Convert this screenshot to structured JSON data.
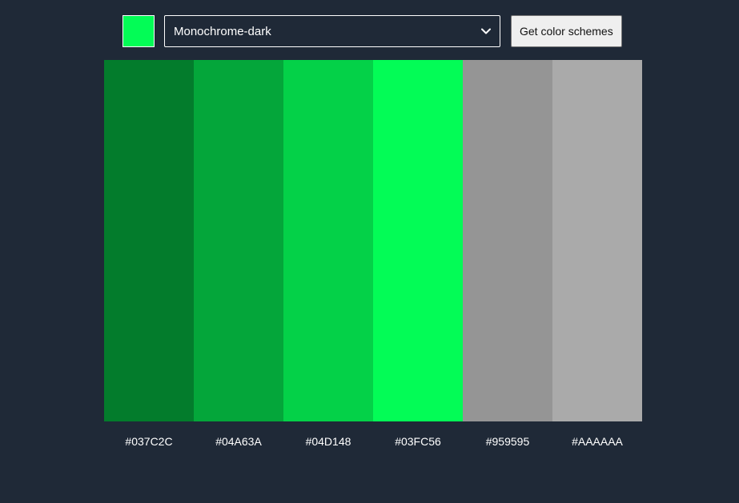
{
  "seed_color": "#03FC56",
  "mode_select": {
    "selected": "Monochrome-dark",
    "chevron_icon": "chevron-down-icon"
  },
  "get_button_label": "Get color schemes",
  "scheme": [
    {
      "hex": "#037C2C"
    },
    {
      "hex": "#04A63A"
    },
    {
      "hex": "#04D148"
    },
    {
      "hex": "#03FC56"
    },
    {
      "hex": "#959595"
    },
    {
      "hex": "#AAAAAA"
    }
  ],
  "colors": {
    "background": "#1f2937",
    "text": "#ffffff"
  }
}
